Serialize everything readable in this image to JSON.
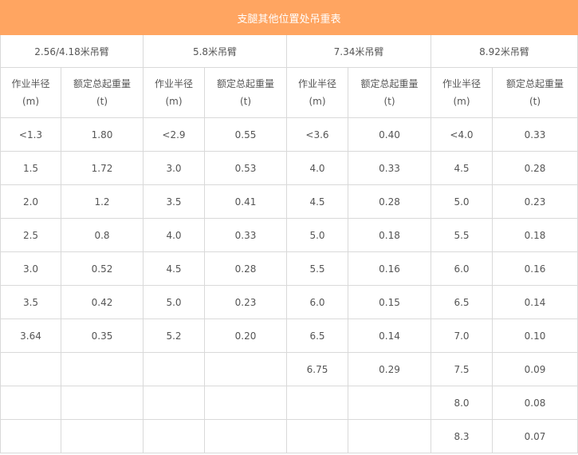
{
  "table": {
    "title": "支腿其他位置处吊重表",
    "booms": [
      "2.56/4.18米吊臂",
      "5.8米吊臂",
      "7.34米吊臂",
      "8.92米吊臂"
    ],
    "col_headers": {
      "radius": "作业半径",
      "radius_unit": "(m)",
      "load": "额定总起重量",
      "load_unit": "(t)"
    },
    "rows": [
      [
        "<1.3",
        "1.80",
        "<2.9",
        "0.55",
        "<3.6",
        "0.40",
        "<4.0",
        "0.33"
      ],
      [
        "1.5",
        "1.72",
        "3.0",
        "0.53",
        "4.0",
        "0.33",
        "4.5",
        "0.28"
      ],
      [
        "2.0",
        "1.2",
        "3.5",
        "0.41",
        "4.5",
        "0.28",
        "5.0",
        "0.23"
      ],
      [
        "2.5",
        "0.8",
        "4.0",
        "0.33",
        "5.0",
        "0.18",
        "5.5",
        "0.18"
      ],
      [
        "3.0",
        "0.52",
        "4.5",
        "0.28",
        "5.5",
        "0.16",
        "6.0",
        "0.16"
      ],
      [
        "3.5",
        "0.42",
        "5.0",
        "0.23",
        "6.0",
        "0.15",
        "6.5",
        "0.14"
      ],
      [
        "3.64",
        "0.35",
        "5.2",
        "0.20",
        "6.5",
        "0.14",
        "7.0",
        "0.10"
      ],
      [
        "",
        "",
        "",
        "",
        "6.75",
        "0.29",
        "7.5",
        "0.09"
      ],
      [
        "",
        "",
        "",
        "",
        "",
        "",
        "8.0",
        "0.08"
      ],
      [
        "",
        "",
        "",
        "",
        "",
        "",
        "8.3",
        "0.07"
      ]
    ]
  },
  "colors": {
    "title_bg": "#ffa561",
    "border": "#d9d9d9",
    "text": "#555555"
  }
}
